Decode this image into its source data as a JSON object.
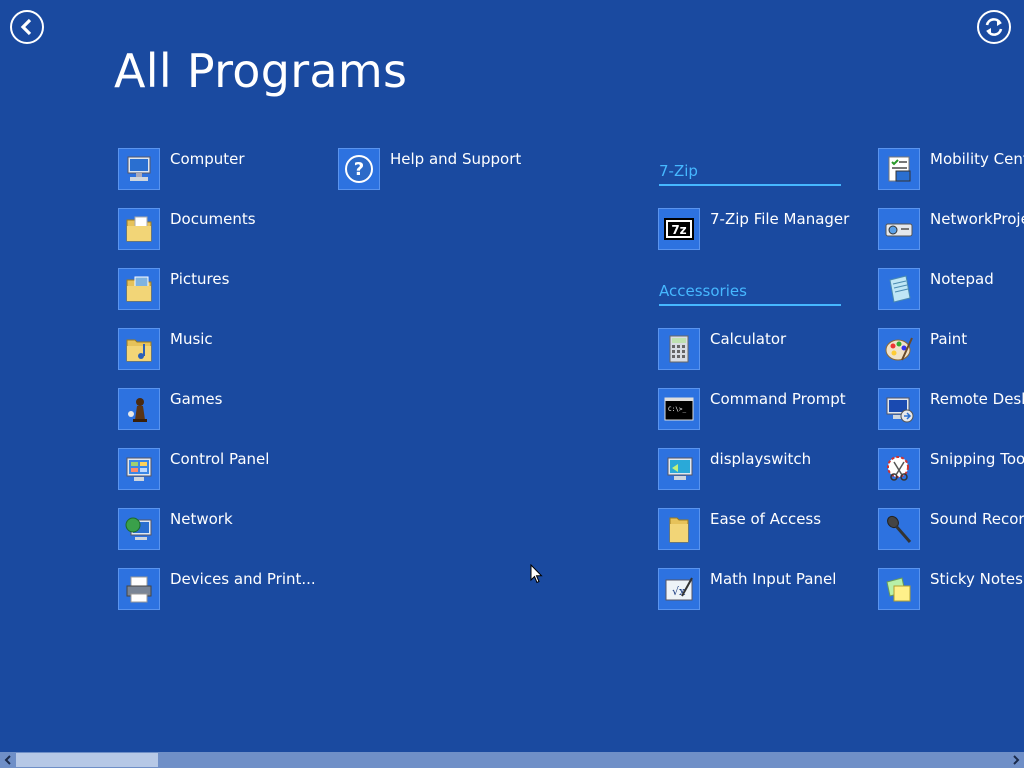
{
  "header": {
    "title": "All Programs"
  },
  "tiles": {
    "computer": "Computer",
    "documents": "Documents",
    "pictures": "Pictures",
    "music": "Music",
    "games": "Games",
    "control_panel": "Control Panel",
    "network": "Network",
    "devices": "Devices and Print...",
    "help": "Help and Support",
    "sevenzip_fm": "7-Zip File Manager",
    "calculator": "Calculator",
    "cmd": "Command Prompt",
    "displayswitch": "displayswitch",
    "ease": "Ease of Access",
    "math": "Math Input Panel",
    "mobility": "Mobility Center",
    "networkproj": "NetworkProjector",
    "notepad": "Notepad",
    "paint": "Paint",
    "remote": "Remote Desktop",
    "snipping": "Snipping Tool",
    "sound": "Sound Recorder",
    "sticky": "Sticky Notes"
  },
  "groups": {
    "sevenzip": "7-Zip",
    "accessories": "Accessories"
  },
  "icons": {
    "back": "back-arrow-icon",
    "refresh": "refresh-icon"
  },
  "colors": {
    "background": "#1a4aa0",
    "tile": "#2d72e0",
    "group_header": "#46b8ff"
  }
}
